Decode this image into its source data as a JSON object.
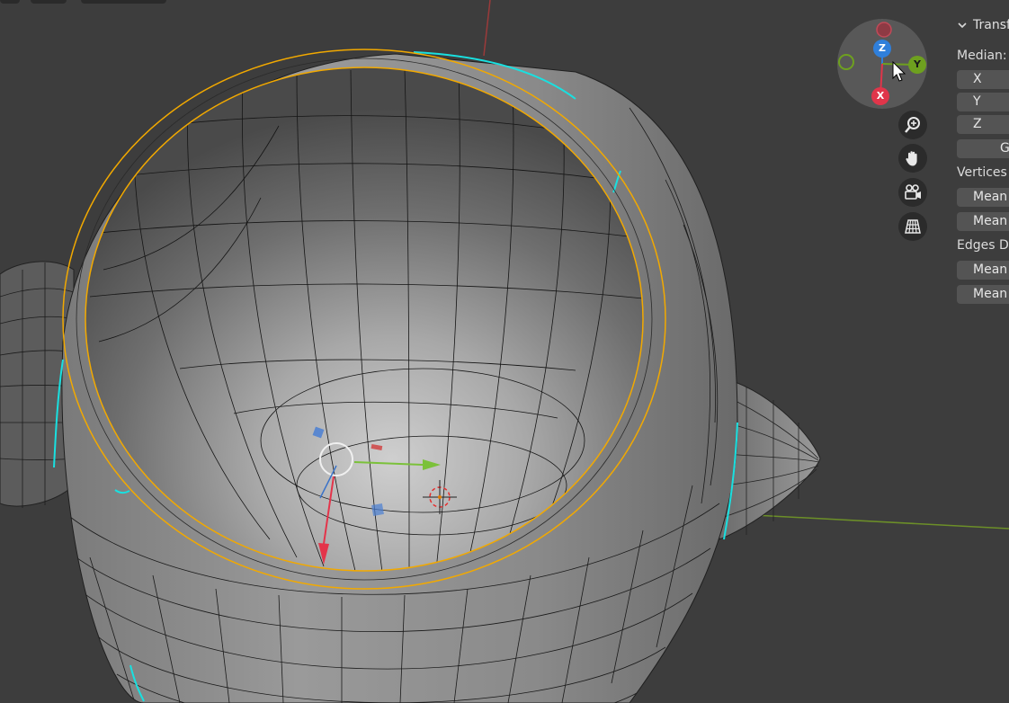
{
  "gizmo": {
    "axes": {
      "z": "Z",
      "y": "Y",
      "x": "X"
    },
    "colors": {
      "z": "#2f7fdb",
      "y": "#6ea01f",
      "x": "#e0354a"
    }
  },
  "nav_tools": [
    "zoom-icon",
    "hand-pan-icon",
    "camera-icon",
    "perspective-grid-icon"
  ],
  "panel": {
    "header": "Transf",
    "median_label": "Median:",
    "x_label": "X",
    "y_label": "Y",
    "z_label": "Z",
    "global_button": "G",
    "vertices_label": "Vertices",
    "vertices_mean_1": "Mean",
    "vertices_mean_2": "Mean",
    "edges_label": "Edges Da",
    "edges_mean_1": "Mean",
    "edges_mean_2": "Mean"
  },
  "colors": {
    "viewport_bg": "#3d3d3d",
    "selection": "#f2a900",
    "seam": "#19e0e0"
  }
}
